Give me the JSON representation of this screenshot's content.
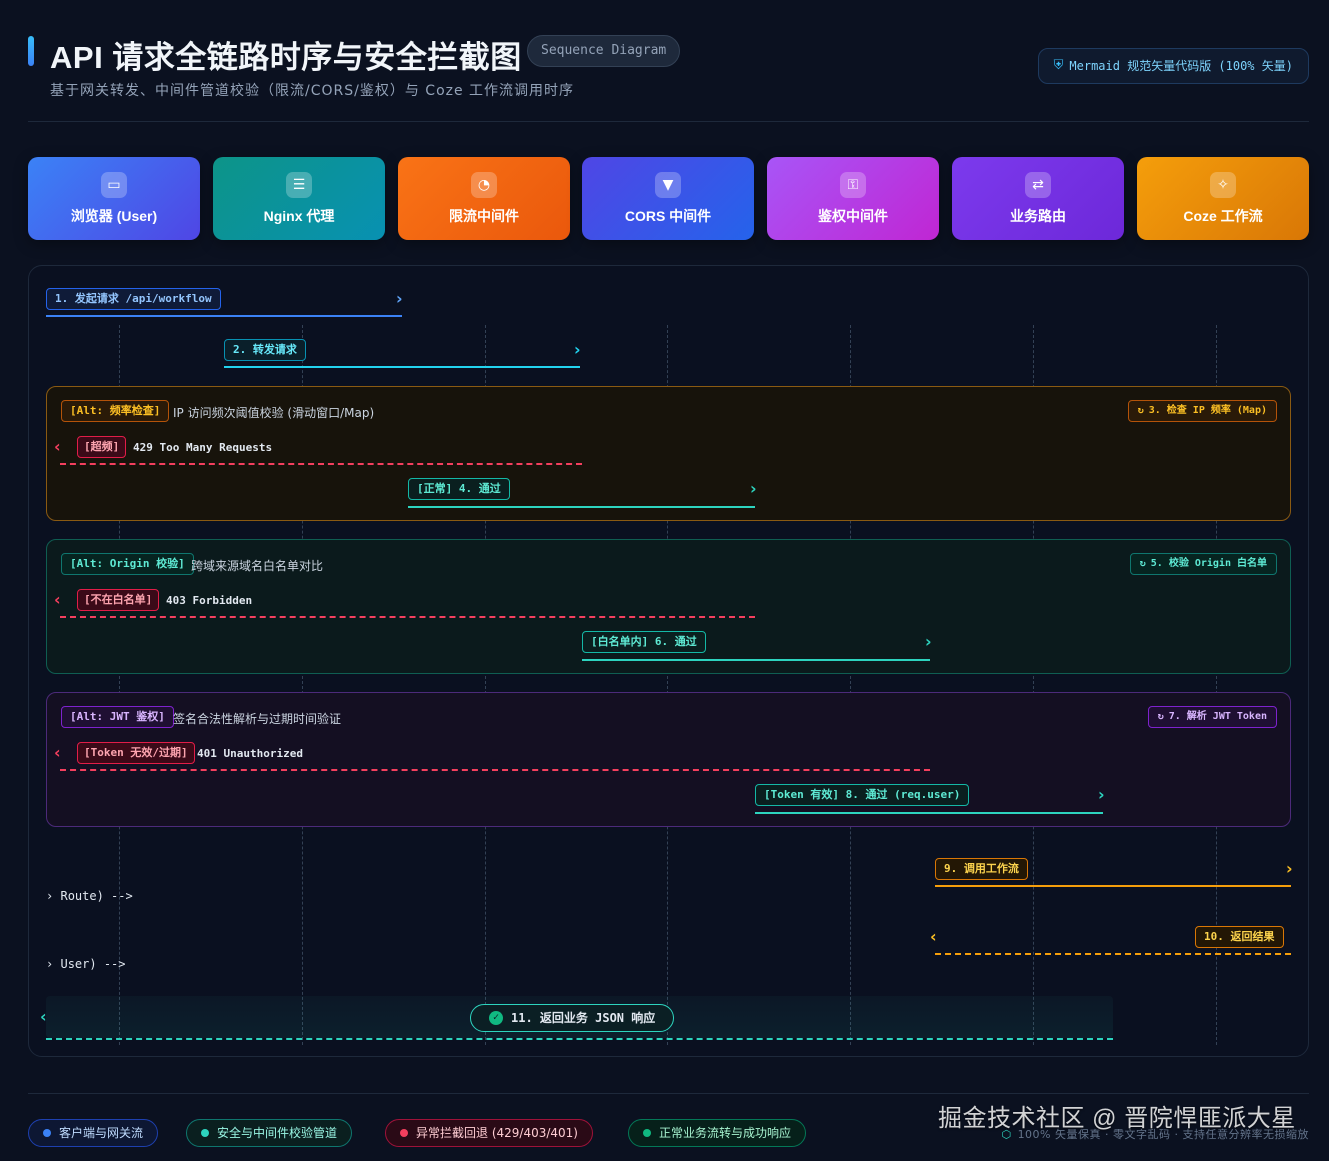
{
  "header": {
    "title": "API 请求全链路时序与安全拦截图",
    "badge": "Sequence Diagram",
    "subtitle": "基于网关转发、中间件管道校验（限流/CORS/鉴权）与 Coze 工作流调用时序",
    "mermaid_badge": "Mermaid 规范矢量代码版 (100% 矢量)"
  },
  "participants": [
    {
      "label": "浏览器 (User)",
      "icon": "monitor-icon",
      "color": "#3b6cf6"
    },
    {
      "label": "Nginx 代理",
      "icon": "server-icon",
      "color": "#0f9d9a"
    },
    {
      "label": "限流中间件",
      "icon": "gauge-icon",
      "color": "#ea6a10"
    },
    {
      "label": "CORS 中间件",
      "icon": "filter-icon",
      "color": "#4f46e5"
    },
    {
      "label": "鉴权中间件",
      "icon": "key-icon",
      "color": "#c026d3"
    },
    {
      "label": "业务路由",
      "icon": "route-icon",
      "color": "#7c3aed"
    },
    {
      "label": "Coze 工作流",
      "icon": "magic-wand-icon",
      "color": "#e8950c"
    }
  ],
  "messages": {
    "m1": "1. 发起请求 /api/workflow",
    "m2": "2. 转发请求",
    "m9": "9. 调用工作流",
    "m10": "10. 返回结果",
    "m11": "11. 返回业务 JSON 响应"
  },
  "alts": [
    {
      "tag": "[Alt: 频率检查]",
      "desc": "IP 访问频次阈值校验 (滑动窗口/Map)",
      "check": "3. 检查 IP 频率 (Map)",
      "error_tag": "[超频]",
      "error_text": "429 Too Many Requests",
      "pass": "[正常] 4. 通过"
    },
    {
      "tag": "[Alt: Origin 校验]",
      "desc": "跨域来源域名白名单对比",
      "check": "5. 校验 Origin 白名单",
      "error_tag": "[不在白名单]",
      "error_text": "403 Forbidden",
      "pass": "[白名单内] 6. 通过"
    },
    {
      "tag": "[Alt: JWT 鉴权]",
      "desc": "签名合法性解析与过期时间验证",
      "check": "7. 解析 JWT Token",
      "error_tag": "[Token 无效/过期]",
      "error_text": "401 Unauthorized",
      "pass": "[Token 有效] 8. 通过 (req.user)"
    }
  ],
  "raw": {
    "route": "Route) -->",
    "user": "User) -->"
  },
  "legend": [
    {
      "label": "客户端与网关流",
      "color": "#3b82f6"
    },
    {
      "label": "安全与中间件校验管道",
      "color": "#2dd4bf"
    },
    {
      "label": "异常拦截回退 (429/403/401)",
      "color": "#f43f5e"
    },
    {
      "label": "正常业务流转与成功响应",
      "color": "#10b981"
    }
  ],
  "footer_note": "100% 矢量保真 · 零文字乱码 · 支持任意分辨率无损缩放",
  "watermark": "掘金技术社区 @ 晋院悍匪派大星"
}
